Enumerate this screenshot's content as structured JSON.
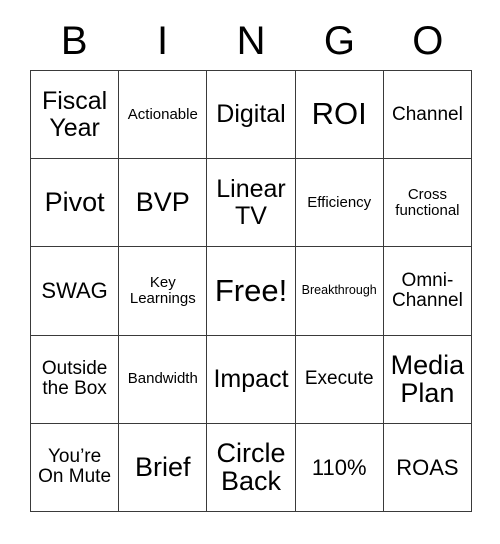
{
  "card": {
    "header": {
      "letters": [
        "B",
        "I",
        "N",
        "G",
        "O"
      ]
    },
    "grid": {
      "rows": [
        [
          {
            "text": "Fiscal Year",
            "size": "fs-lg"
          },
          {
            "text": "Actionable",
            "size": "fs-xs"
          },
          {
            "text": "Digital",
            "size": "fs-lg"
          },
          {
            "text": "ROI",
            "size": "fs-xxl"
          },
          {
            "text": "Channel",
            "size": "fs-sm"
          }
        ],
        [
          {
            "text": "Pivot",
            "size": "fs-xl"
          },
          {
            "text": "BVP",
            "size": "fs-xl"
          },
          {
            "text": "Linear TV",
            "size": "fs-lg"
          },
          {
            "text": "Efficiency",
            "size": "fs-xs"
          },
          {
            "text": "Cross functional",
            "size": "fs-xs"
          }
        ],
        [
          {
            "text": "SWAG",
            "size": "fs-md"
          },
          {
            "text": "Key Learnings",
            "size": "fs-xs"
          },
          {
            "text": "Free!",
            "size": "fs-xxl"
          },
          {
            "text": "Breakthrough",
            "size": "fs-xxs"
          },
          {
            "text": "Omni-Channel",
            "size": "fs-sm"
          }
        ],
        [
          {
            "text": "Outside the Box",
            "size": "fs-sm"
          },
          {
            "text": "Bandwidth",
            "size": "fs-xs"
          },
          {
            "text": "Impact",
            "size": "fs-lg"
          },
          {
            "text": "Execute",
            "size": "fs-sm"
          },
          {
            "text": "Media Plan",
            "size": "fs-xl"
          }
        ],
        [
          {
            "text": "You’re On Mute",
            "size": "fs-sm"
          },
          {
            "text": "Brief",
            "size": "fs-xl"
          },
          {
            "text": "Circle Back",
            "size": "fs-xl"
          },
          {
            "text": "110%",
            "size": "fs-md"
          },
          {
            "text": "ROAS",
            "size": "fs-md"
          }
        ]
      ]
    },
    "colors": {
      "background": "#ffffff",
      "text": "#000000",
      "grid_line": "#3a3a3a"
    }
  }
}
